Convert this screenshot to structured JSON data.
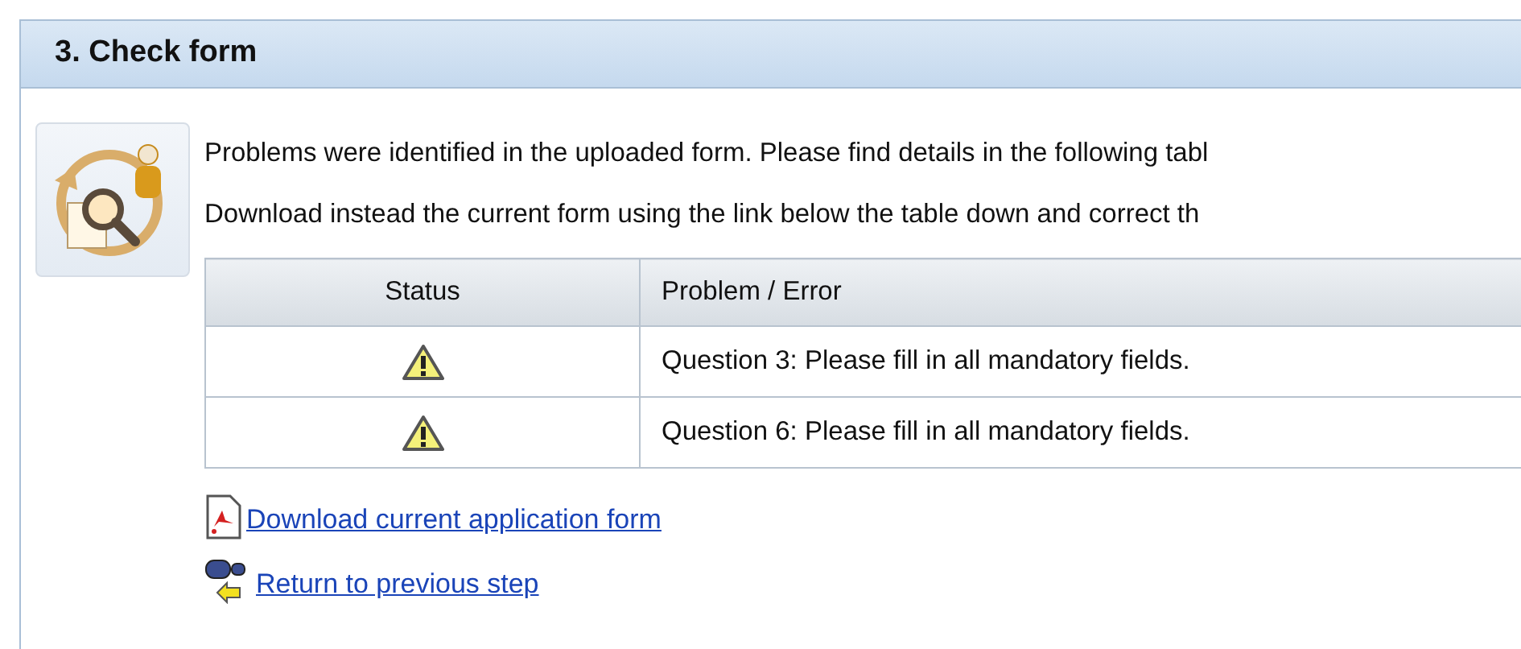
{
  "panel": {
    "title": "3. Check form"
  },
  "message": [
    "Problems were identified in the uploaded form. Please find details in the following tabl",
    "Download instead the current form using the link below the table down and correct th"
  ],
  "table": {
    "columns": [
      "Status",
      "Problem / Error"
    ],
    "rows": [
      {
        "kind": "warning",
        "problem": "Question 3: Please fill in all mandatory fields."
      },
      {
        "kind": "warning",
        "problem": "Question 6: Please fill in all mandatory fields."
      }
    ]
  },
  "links": [
    {
      "kind": "pdf",
      "label": "Download current application form"
    },
    {
      "kind": "back",
      "label": "Return to previous step"
    }
  ]
}
